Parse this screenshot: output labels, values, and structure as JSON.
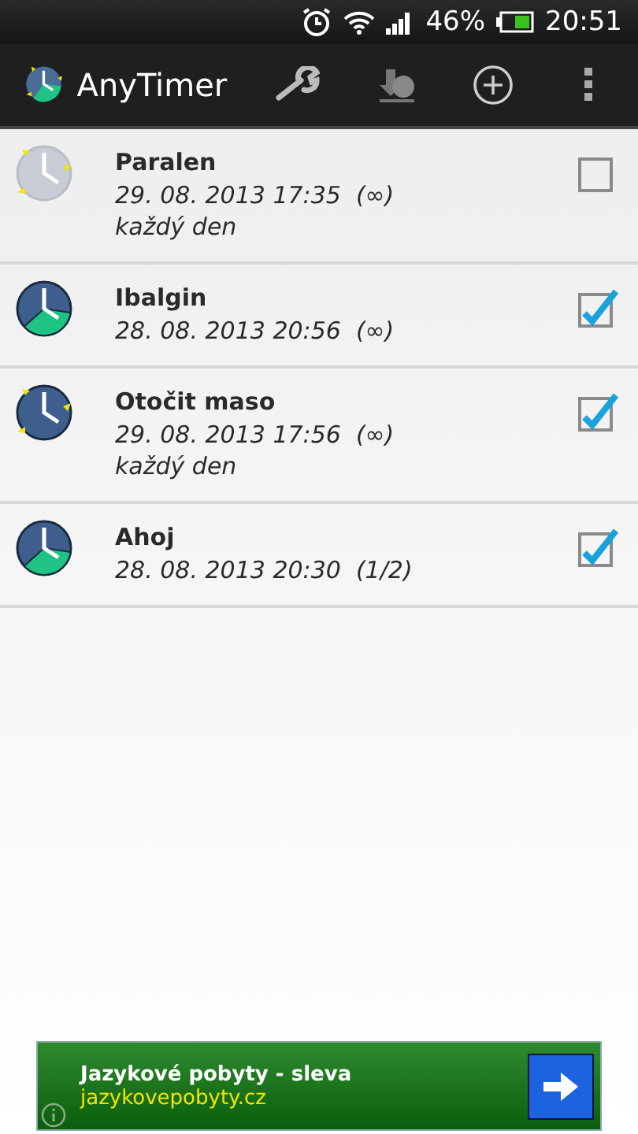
{
  "status_bar": {
    "battery_text": "46%",
    "time": "20:51"
  },
  "app_bar": {
    "title": "AnyTimer"
  },
  "timers": [
    {
      "name": "Paralen",
      "when": "29. 08. 2013 17:35  (∞)",
      "repeat": "každý den",
      "marks": true,
      "checked": false
    },
    {
      "name": "Ibalgin",
      "when": "28. 08. 2013 20:56  (∞)",
      "marks": false,
      "checked": true
    },
    {
      "name": "Otočit maso",
      "when": "29. 08. 2013 17:56  (∞)",
      "repeat": "každý den",
      "marks": true,
      "checked": true
    },
    {
      "name": "Ahoj",
      "when": "28. 08. 2013 20:30  (1/2)",
      "marks": false,
      "checked": true
    }
  ],
  "ad": {
    "headline": "Jazykové pobyty - sleva",
    "url": "jazykovepobyty.cz"
  }
}
